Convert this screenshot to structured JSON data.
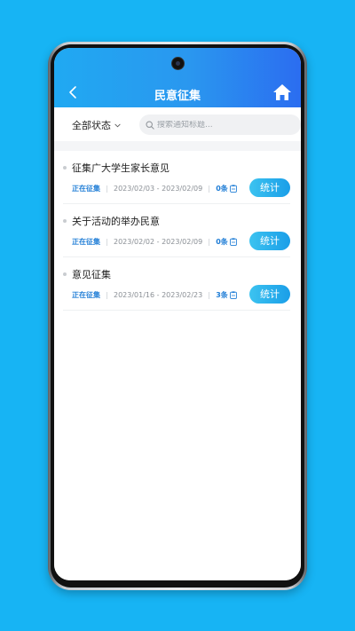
{
  "header": {
    "title": "民意征集"
  },
  "filter": {
    "status_label": "全部状态",
    "search_placeholder": "搜索通知标题...",
    "search_value": ""
  },
  "items": [
    {
      "title": "征集广大学生家长意见",
      "status": "正在征集",
      "date_range": "2023/02/03 - 2023/02/09",
      "count": "0条",
      "button": "统计"
    },
    {
      "title": "关于活动的举办民意",
      "status": "正在征集",
      "date_range": "2023/02/02 - 2023/02/09",
      "count": "0条",
      "button": "统计"
    },
    {
      "title": "意见征集",
      "status": "正在征集",
      "date_range": "2023/01/16 - 2023/02/23",
      "count": "3条",
      "button": "统计"
    }
  ],
  "colors": {
    "background": "#17b4f4",
    "header_start": "#20a9f2",
    "header_end": "#2b6df0",
    "accent": "#1f7dd6"
  },
  "icons": {
    "back": "chevron-left-icon",
    "home": "home-icon",
    "dropdown": "chevron-down-icon",
    "search": "search-icon",
    "count": "clipboard-icon"
  }
}
